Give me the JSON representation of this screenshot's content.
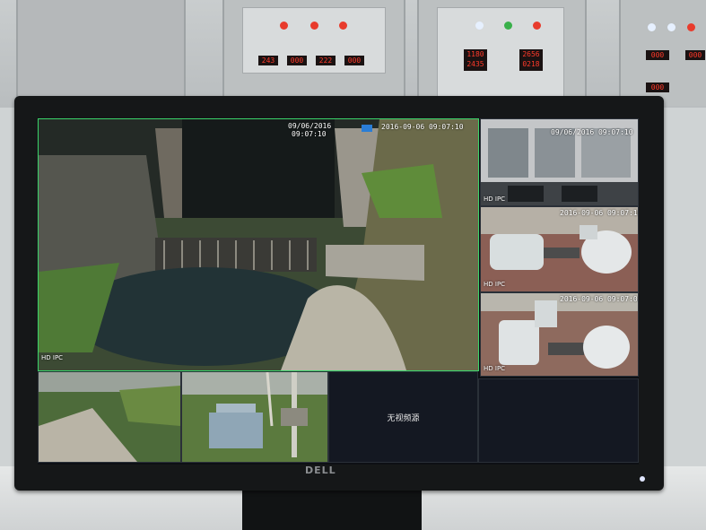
{
  "main_view": {
    "date": "09/06/2016",
    "time": "09:07:10",
    "label": "HD IPC",
    "overlay_timestamp": "2016-09-06 09:07:10"
  },
  "side_views": [
    {
      "timestamp": "09/06/2016 09:07:10",
      "label": "HD IPC"
    },
    {
      "timestamp": "2016-09-06 09:07:10",
      "label": "HD IPC"
    },
    {
      "timestamp": "2016-09-06 09:07:04",
      "label": "HD IPC"
    }
  ],
  "bottom_views": [
    {
      "label": ""
    },
    {
      "label": ""
    },
    {
      "label": "无视频源"
    },
    {
      "label": ""
    }
  ],
  "monitor": {
    "brand": "DELL"
  },
  "control_panel": {
    "meters_left": [
      "243",
      "000",
      "222",
      "000"
    ],
    "meters_mid": [
      "1180",
      "2656",
      "2435",
      "0218"
    ],
    "meters_right": [
      "000",
      "000",
      "000"
    ]
  }
}
